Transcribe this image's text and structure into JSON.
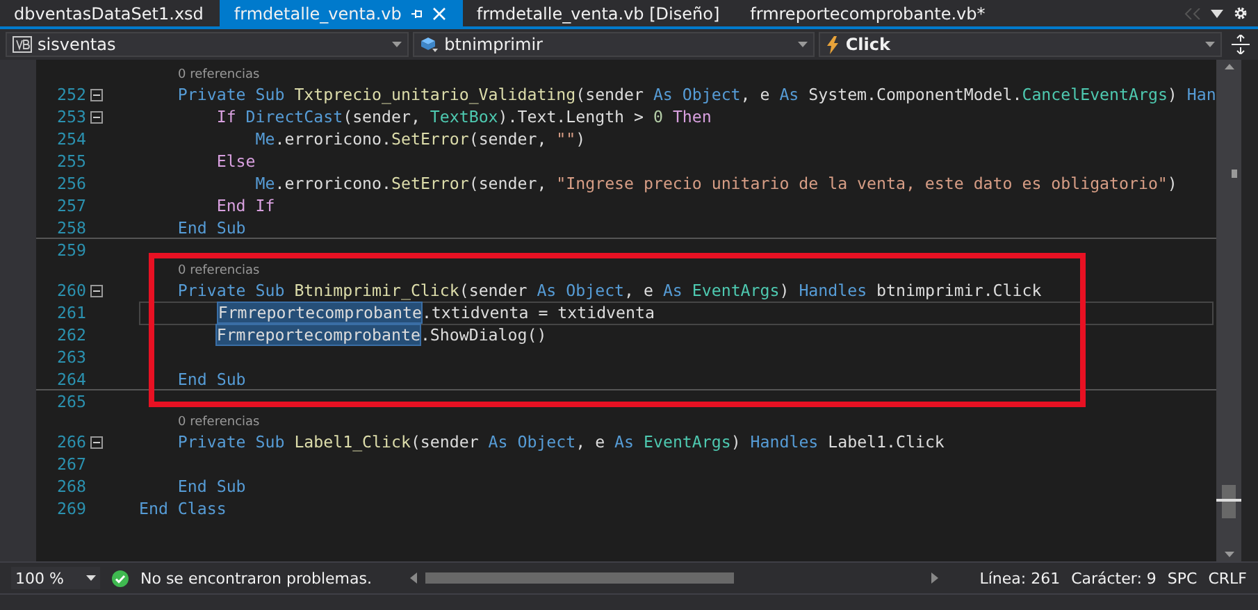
{
  "tabs": [
    {
      "label": "dbventasDataSet1.xsd",
      "selected": false
    },
    {
      "label": "frmdetalle_venta.vb",
      "selected": true
    },
    {
      "label": "frmdetalle_venta.vb [Diseño]",
      "selected": false
    },
    {
      "label": "frmreportecomprobante.vb*",
      "selected": false
    }
  ],
  "nav_bar": {
    "project": "sisventas",
    "object": "btnimprimir",
    "event": "Click"
  },
  "code_lines": [
    {
      "kind": "lens",
      "text": "0 referencias"
    },
    {
      "kind": "code",
      "number": "252",
      "fold": true,
      "current": false,
      "separator_after": false,
      "tokens": [
        {
          "t": "    Private Sub ",
          "kind": "kw"
        },
        {
          "t": "Txtprecio_unitario_Validating",
          "kind": "method"
        },
        {
          "t": "(sender ",
          "kind": "plain"
        },
        {
          "t": "As Object",
          "kind": "kw"
        },
        {
          "t": ", e ",
          "kind": "plain"
        },
        {
          "t": "As ",
          "kind": "kw"
        },
        {
          "t": "System.ComponentModel.",
          "kind": "plain"
        },
        {
          "t": "CancelEventArgs",
          "kind": "type"
        },
        {
          "t": ") ",
          "kind": "plain"
        },
        {
          "t": "Han",
          "kind": "kw"
        }
      ]
    },
    {
      "kind": "code",
      "number": "253",
      "fold": true,
      "current": false,
      "separator_after": false,
      "tokens": [
        {
          "t": "        If ",
          "kind": "ctrl"
        },
        {
          "t": "DirectCast",
          "kind": "kw"
        },
        {
          "t": "(sender, ",
          "kind": "plain"
        },
        {
          "t": "TextBox",
          "kind": "type"
        },
        {
          "t": ").Text.Length > ",
          "kind": "plain"
        },
        {
          "t": "0",
          "kind": "num"
        },
        {
          "t": " Then",
          "kind": "ctrl"
        }
      ]
    },
    {
      "kind": "code",
      "number": "254",
      "fold": false,
      "current": false,
      "separator_after": false,
      "tokens": [
        {
          "t": "            Me",
          "kind": "kw"
        },
        {
          "t": ".erroricono.",
          "kind": "plain"
        },
        {
          "t": "SetError",
          "kind": "method"
        },
        {
          "t": "(sender, ",
          "kind": "plain"
        },
        {
          "t": "\"\"",
          "kind": "str"
        },
        {
          "t": ")",
          "kind": "plain"
        }
      ]
    },
    {
      "kind": "code",
      "number": "255",
      "fold": false,
      "current": false,
      "separator_after": false,
      "tokens": [
        {
          "t": "        Else",
          "kind": "ctrl"
        }
      ]
    },
    {
      "kind": "code",
      "number": "256",
      "fold": false,
      "current": false,
      "separator_after": false,
      "tokens": [
        {
          "t": "            Me",
          "kind": "kw"
        },
        {
          "t": ".erroricono.",
          "kind": "plain"
        },
        {
          "t": "SetError",
          "kind": "method"
        },
        {
          "t": "(sender, ",
          "kind": "plain"
        },
        {
          "t": "\"Ingrese precio unitario de la venta, este dato es obligatorio\"",
          "kind": "str"
        },
        {
          "t": ")",
          "kind": "plain"
        }
      ]
    },
    {
      "kind": "code",
      "number": "257",
      "fold": false,
      "current": false,
      "separator_after": false,
      "tokens": [
        {
          "t": "        End If",
          "kind": "ctrl"
        }
      ]
    },
    {
      "kind": "code",
      "number": "258",
      "fold": false,
      "current": false,
      "separator_after": true,
      "tokens": [
        {
          "t": "    End Sub",
          "kind": "kw"
        }
      ]
    },
    {
      "kind": "code",
      "number": "259",
      "fold": false,
      "current": false,
      "separator_after": false
    },
    {
      "kind": "lens",
      "text": "0 referencias"
    },
    {
      "kind": "code",
      "number": "260",
      "fold": true,
      "current": false,
      "separator_after": false,
      "tokens": [
        {
          "t": "    Private Sub ",
          "kind": "kw"
        },
        {
          "t": "Btnimprimir_Click",
          "kind": "method"
        },
        {
          "t": "(sender ",
          "kind": "plain"
        },
        {
          "t": "As Object",
          "kind": "kw"
        },
        {
          "t": ", e ",
          "kind": "plain"
        },
        {
          "t": "As ",
          "kind": "kw"
        },
        {
          "t": "EventArgs",
          "kind": "type"
        },
        {
          "t": ") ",
          "kind": "plain"
        },
        {
          "t": "Handles ",
          "kind": "kw"
        },
        {
          "t": "btnimprimir.Click",
          "kind": "plain"
        }
      ]
    },
    {
      "kind": "code",
      "number": "261",
      "fold": false,
      "current": true,
      "separator_after": false,
      "tokens": [
        {
          "t": "        Frmreportecomprobante",
          "kind": "selection"
        },
        {
          "t": ".txtidventa = txtidventa",
          "kind": "plain"
        }
      ]
    },
    {
      "kind": "code",
      "number": "262",
      "fold": false,
      "current": false,
      "separator_after": false,
      "tokens": [
        {
          "t": "        Frmreportecomprobante",
          "kind": "selection"
        },
        {
          "t": ".ShowDialog()",
          "kind": "plain"
        }
      ]
    },
    {
      "kind": "code",
      "number": "263",
      "fold": false,
      "current": false,
      "separator_after": false
    },
    {
      "kind": "code",
      "number": "264",
      "fold": false,
      "current": false,
      "separator_after": true,
      "tokens": [
        {
          "t": "    End Sub",
          "kind": "kw"
        }
      ]
    },
    {
      "kind": "code",
      "number": "265",
      "fold": false,
      "current": false,
      "separator_after": false
    },
    {
      "kind": "lens",
      "text": "0 referencias"
    },
    {
      "kind": "code",
      "number": "266",
      "fold": true,
      "current": false,
      "separator_after": false,
      "tokens": [
        {
          "t": "    Private Sub ",
          "kind": "kw"
        },
        {
          "t": "Label1_Click",
          "kind": "method"
        },
        {
          "t": "(sender ",
          "kind": "plain"
        },
        {
          "t": "As Object",
          "kind": "kw"
        },
        {
          "t": ", e ",
          "kind": "plain"
        },
        {
          "t": "As ",
          "kind": "kw"
        },
        {
          "t": "EventArgs",
          "kind": "type"
        },
        {
          "t": ") ",
          "kind": "plain"
        },
        {
          "t": "Handles ",
          "kind": "kw"
        },
        {
          "t": "Label1.Click",
          "kind": "plain"
        }
      ]
    },
    {
      "kind": "code",
      "number": "267",
      "fold": false,
      "current": false,
      "separator_after": false
    },
    {
      "kind": "code",
      "number": "268",
      "fold": false,
      "current": false,
      "separator_after": false,
      "tokens": [
        {
          "t": "    End Sub",
          "kind": "kw"
        }
      ]
    },
    {
      "kind": "code",
      "number": "269",
      "fold": false,
      "current": false,
      "separator_after": false,
      "tokens": [
        {
          "t": "End Class",
          "kind": "kw"
        }
      ]
    }
  ],
  "status_bar": {
    "zoom": "100 %",
    "problems": "No se encontraron problemas.",
    "line": "Línea: 261",
    "column": "Carácter: 9",
    "whitespace": "SPC",
    "line_ending": "CRLF"
  }
}
